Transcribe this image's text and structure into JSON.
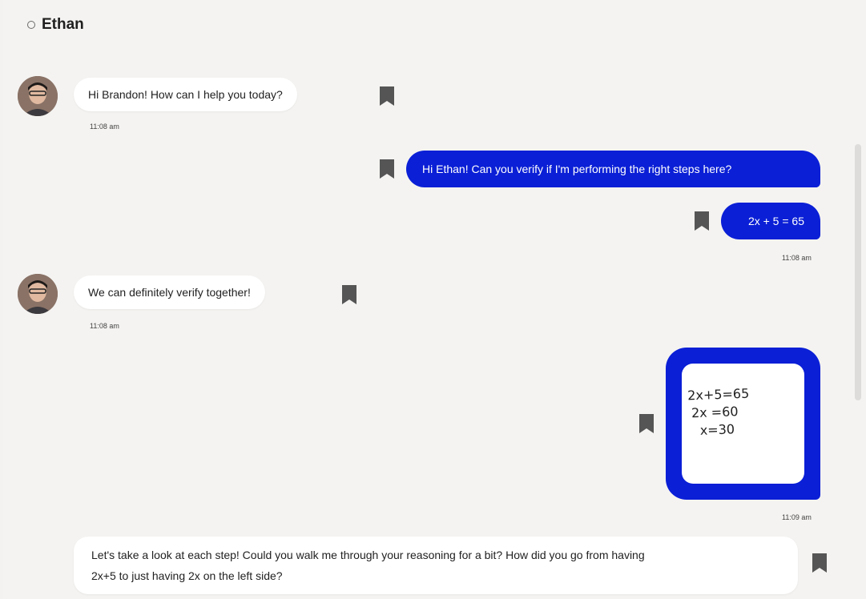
{
  "header": {
    "name": "Ethan",
    "status_icon": "status-ring-icon"
  },
  "messages": [
    {
      "from": "Ethan",
      "text": "Hi Brandon! How can I help you today?",
      "time": "11:08 am"
    },
    {
      "from": "Brandon",
      "text": "Hi Ethan! Can you verify if I'm performing the right steps here?"
    },
    {
      "from": "Brandon",
      "text": "2x + 5 = 65",
      "time": "11:08 am"
    },
    {
      "from": "Ethan",
      "text": "We can definitely verify together!",
      "time": "11:08 am"
    },
    {
      "from": "Brandon",
      "type": "image",
      "image_lines": [
        "2x+5=65",
        "2x =60",
        "x=30"
      ],
      "time": "11:09 am"
    },
    {
      "from": "Ethan",
      "text_line1": "Let's take a look at each step! Could you walk me through your reasoning for a bit? How did you go from having",
      "text_line2": "2x+5 to just having 2x on the left side?"
    }
  ],
  "colors": {
    "outgoing_bubble": "#0a1fd6",
    "incoming_bubble": "#ffffff",
    "background": "#f4f3f1",
    "bookmark": "#555555"
  },
  "icons": {
    "bookmark": "bookmark-icon",
    "avatar": "avatar"
  }
}
